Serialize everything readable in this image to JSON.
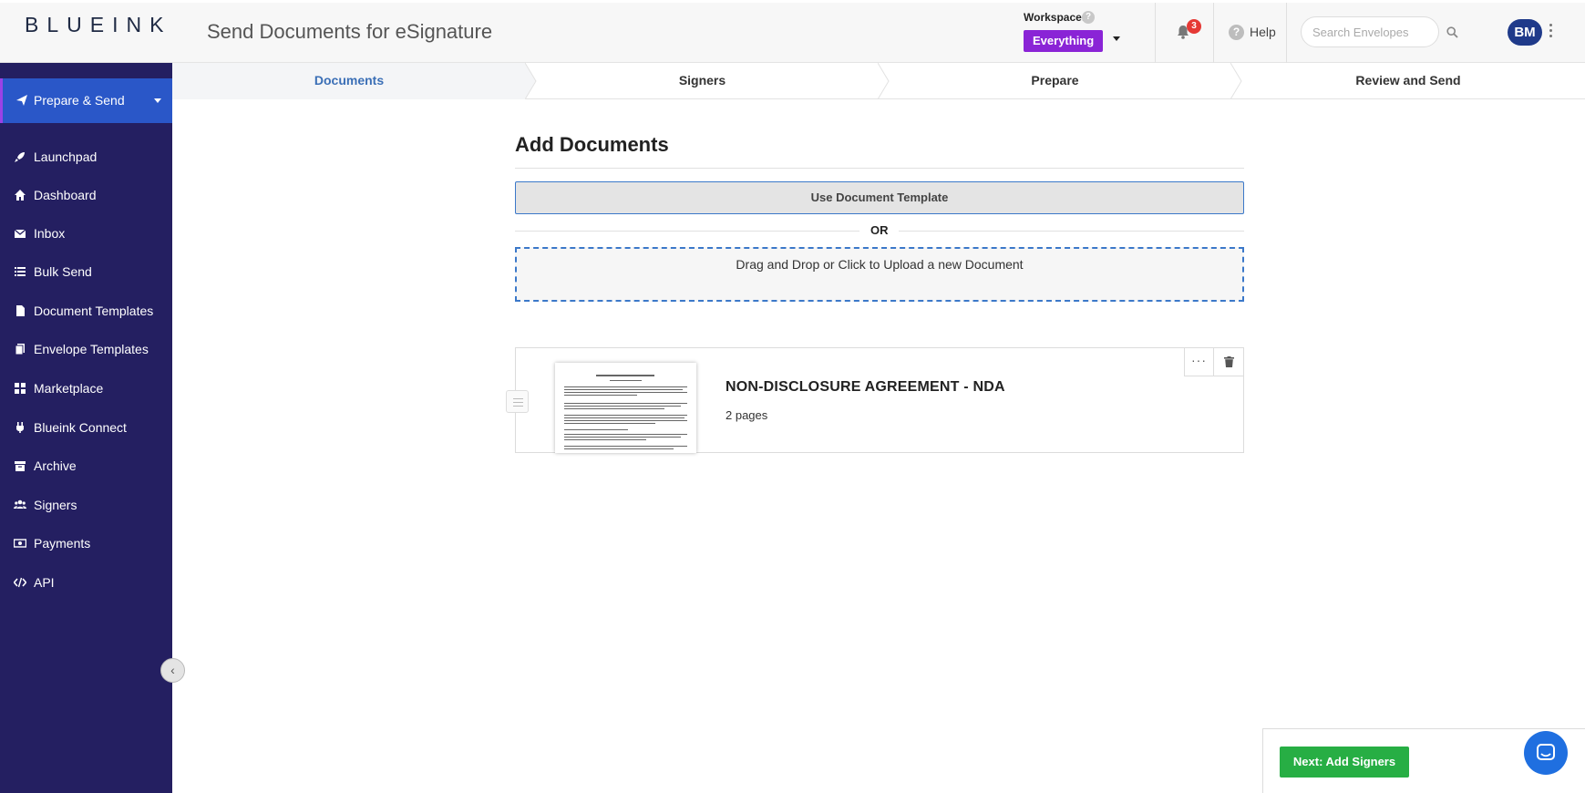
{
  "header": {
    "logo_text": "BLUEINK",
    "app_title": "Send Documents for eSignature",
    "workspace_label": "Workspace:",
    "workspace_help": "?",
    "workspace_value": "Everything",
    "notification_count": "3",
    "help_label": "Help",
    "search_placeholder": "Search Envelopes",
    "avatar_initials": "BM"
  },
  "sidebar": {
    "primary_action": "Prepare & Send",
    "items": [
      {
        "label": "Launchpad",
        "icon": "rocket-icon"
      },
      {
        "label": "Dashboard",
        "icon": "home-icon"
      },
      {
        "label": "Inbox",
        "icon": "envelope-icon"
      },
      {
        "label": "Bulk Send",
        "icon": "list-icon"
      },
      {
        "label": "Document Templates",
        "icon": "file-icon"
      },
      {
        "label": "Envelope Templates",
        "icon": "copy-icon"
      },
      {
        "label": "Marketplace",
        "icon": "grid-icon"
      },
      {
        "label": "Blueink Connect",
        "icon": "plug-icon"
      },
      {
        "label": "Archive",
        "icon": "archive-icon"
      },
      {
        "label": "Signers",
        "icon": "users-icon"
      },
      {
        "label": "Payments",
        "icon": "money-icon"
      },
      {
        "label": "API",
        "icon": "code-icon"
      }
    ],
    "collapse_label": "‹"
  },
  "steps": [
    {
      "label": "Documents",
      "active": true
    },
    {
      "label": "Signers",
      "active": false
    },
    {
      "label": "Prepare",
      "active": false
    },
    {
      "label": "Review and Send",
      "active": false
    }
  ],
  "main": {
    "title": "Add Documents",
    "template_button": "Use Document Template",
    "or_label": "OR",
    "dropzone_text": "Drag and Drop or Click to Upload a new Document",
    "document": {
      "name": "NON-DISCLOSURE AGREEMENT - NDA",
      "pages": "2 pages"
    },
    "more_label": "···"
  },
  "footer": {
    "next_button": "Next: Add Signers"
  },
  "colors": {
    "sidebar_bg": "#241f61",
    "primary_action_bg": "#2a57c8",
    "workspace_bg": "#8a24d6",
    "next_button_bg": "#27ae44",
    "active_step_text": "#3b6fb6",
    "chat_bg": "#1f6fe0"
  }
}
